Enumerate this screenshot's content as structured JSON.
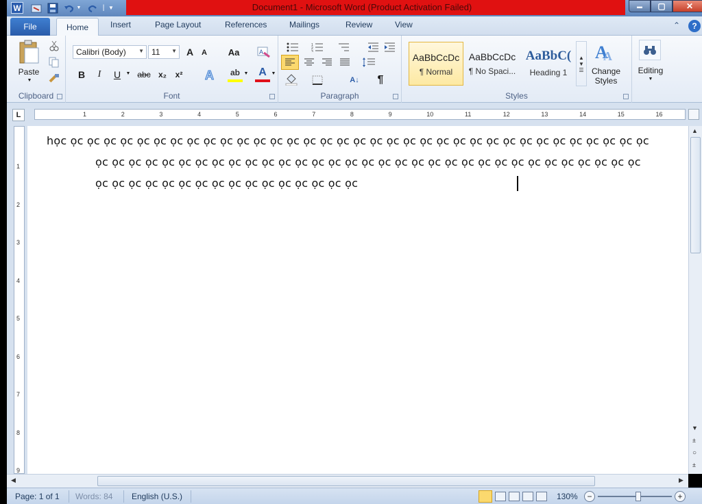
{
  "window": {
    "title": "Document1  -  Microsoft Word (Product Activation Failed)",
    "app_icon_letter": "W",
    "minimize_glyph": "▬",
    "maximize_glyph": "▢",
    "close_glyph": "✕"
  },
  "tabs": {
    "file": "File",
    "home": "Home",
    "insert": "Insert",
    "page_layout": "Page Layout",
    "references": "References",
    "mailings": "Mailings",
    "review": "Review",
    "view": "View",
    "help_glyph": "?",
    "minimize_ribbon_glyph": "⌃"
  },
  "ribbon": {
    "clipboard": {
      "label": "Clipboard",
      "paste": "Paste"
    },
    "font": {
      "label": "Font",
      "font_name": "Calibri (Body)",
      "font_size": "11",
      "grow": "A",
      "shrink": "A",
      "change_case": "Aa",
      "bold": "B",
      "italic": "I",
      "underline": "U",
      "strikethrough": "abc",
      "subscript": "x₂",
      "superscript": "x²",
      "highlight": "ab",
      "font_color": "A"
    },
    "paragraph": {
      "label": "Paragraph",
      "pilcrow": "¶",
      "sort": "A↓"
    },
    "styles": {
      "label": "Styles",
      "items": [
        {
          "sample": "AaBbCcDc",
          "name": "¶ Normal"
        },
        {
          "sample": "AaBbCcDc",
          "name": "¶ No Spaci..."
        },
        {
          "sample": "AaBbC(",
          "name": "Heading 1"
        }
      ],
      "change_styles": "Change Styles"
    },
    "editing": {
      "label": "Editing"
    }
  },
  "ruler": {
    "corner": "L",
    "numbers": [
      "1",
      "2",
      "3",
      "4",
      "5",
      "6",
      "7",
      "8",
      "9",
      "10",
      "11",
      "12",
      "13",
      "14",
      "15",
      "16"
    ],
    "vertical_numbers": [
      "1",
      "2",
      "3",
      "4",
      "5",
      "6",
      "7",
      "8",
      "9"
    ]
  },
  "document": {
    "lines": [
      "học ọc ọc ọc ọc ọc ọc ọc ọc ọc ọc ọc ọc ọc ọc ọc ọc ọc ọc ọc ọc ọc ọc ọc ọc ọc ọc ọc ọc ọc ọc ọc ọc ọc ọc ọc",
      "ọc ọc ọc ọc ọc ọc ọc ọc ọc ọc ọc ọc ọc ọc ọc ọc ọc ọc ọc ọc ọc ọc ọc ọc ọc ọc ọc ọc ọc ọc ọc ọc ọc",
      "ọc ọc ọc ọc ọc ọc ọc ọc ọc ọc ọc ọc ọc ọc ọc ọc"
    ]
  },
  "status": {
    "page": "Page: 1 of 1",
    "words": "Words: 84",
    "language": "English (U.S.)",
    "zoom": "130%",
    "zoom_minus": "−",
    "zoom_plus": "+"
  },
  "colors": {
    "title_bar_red": "#e01111",
    "file_tab": "#2a5caa",
    "ribbon_bg": "#e3ebf6"
  }
}
